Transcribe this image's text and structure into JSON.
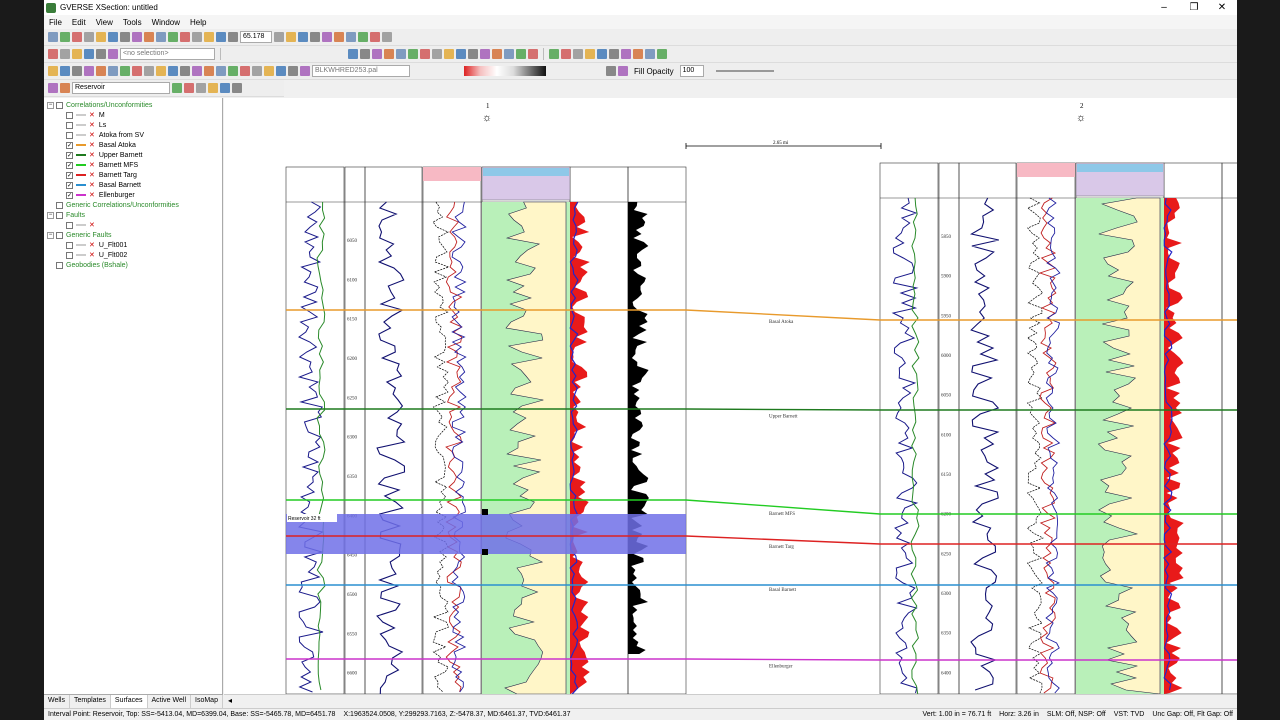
{
  "window": {
    "title": "GVERSE XSection: untitled",
    "minimize": "–",
    "maximize": "❐",
    "close": "✕"
  },
  "menu": [
    "File",
    "Edit",
    "View",
    "Tools",
    "Window",
    "Help"
  ],
  "toolbar": {
    "zoom_value": "65.178",
    "selection_placeholder": "<no selection>",
    "palette_value": "BLKWHRED253.pal",
    "fill_opacity_label": "Fill Opacity",
    "fill_opacity_value": "100",
    "reservoir_combo": "Reservoir"
  },
  "tree": [
    {
      "label": "Correlations/Unconformities",
      "level": 0,
      "expand": "−",
      "checked": false,
      "green": true
    },
    {
      "label": "M",
      "level": 1,
      "checked": false,
      "color": "#cccccc"
    },
    {
      "label": "Ls",
      "level": 1,
      "checked": false,
      "color": "#cccccc"
    },
    {
      "label": "Atoka from SV",
      "level": 1,
      "checked": false,
      "color": "#cccccc"
    },
    {
      "label": "Basal Atoka",
      "level": 1,
      "checked": true,
      "color": "#e89a2c"
    },
    {
      "label": "Upper Barnett",
      "level": 1,
      "checked": true,
      "color": "#1f7a1f"
    },
    {
      "label": "Barnett MFS",
      "level": 1,
      "checked": true,
      "color": "#22cc22"
    },
    {
      "label": "Barnett Targ",
      "level": 1,
      "checked": true,
      "color": "#dd2222"
    },
    {
      "label": "Basal Barnett",
      "level": 1,
      "checked": true,
      "color": "#2a8fd0"
    },
    {
      "label": "Ellenburger",
      "level": 1,
      "checked": true,
      "color": "#cc33cc"
    },
    {
      "label": "Generic Correlations/Unconformities",
      "level": 0,
      "expand": "",
      "checked": false,
      "green": true
    },
    {
      "label": "Faults",
      "level": 0,
      "expand": "−",
      "checked": false,
      "green": true
    },
    {
      "label": "",
      "level": 1,
      "checked": false,
      "color": "#cccccc"
    },
    {
      "label": "Generic Faults",
      "level": 0,
      "expand": "−",
      "checked": false,
      "green": true
    },
    {
      "label": "U_Flt001",
      "level": 1,
      "checked": false,
      "color": "#cccccc"
    },
    {
      "label": "U_Flt002",
      "level": 1,
      "checked": false,
      "color": "#cccccc"
    },
    {
      "label": "Geobodies (Bshale)",
      "level": 0,
      "expand": "",
      "checked": false,
      "green": true
    }
  ],
  "bottom_tabs": [
    "Wells",
    "Templates",
    "Surfaces",
    "Active Well",
    "IsoMap"
  ],
  "active_tab": "Surfaces",
  "canvas": {
    "well1_label": "1",
    "well2_label": "2",
    "scale_label": "2.65 mi",
    "reservoir_label": "Reservoir 32 ft",
    "well1_depths": [
      "6050",
      "6100",
      "6150",
      "6200",
      "6250",
      "6300",
      "6350",
      "6400",
      "6450",
      "6500",
      "6550",
      "6600"
    ],
    "well2_depths": [
      "5850",
      "5900",
      "5950",
      "6000",
      "6050",
      "6100",
      "6150",
      "6200",
      "6250",
      "6300",
      "6350",
      "6400"
    ],
    "surfaces": [
      {
        "name": "Basal Atoka",
        "color": "#e89a2c"
      },
      {
        "name": "Upper Barnett",
        "color": "#1f7a1f"
      },
      {
        "name": "Barnett MFS",
        "color": "#22cc22"
      },
      {
        "name": "Barnett Targ",
        "color": "#dd2222"
      },
      {
        "name": "Basal Barnett",
        "color": "#2a8fd0"
      },
      {
        "name": "Ellenburger",
        "color": "#cc33cc"
      }
    ]
  },
  "status": {
    "interval": "Interval Point: Reservoir, Top: SS=-5413.04, MD=6399.04, Base: SS=-5465.78, MD=6451.78",
    "coords": "X:1963524.0508, Y:299293.7163, Z:-5478.37, MD:6461.37, TVD:6461.37",
    "vert": "Vert: 1.00 in = 76.71 ft",
    "horz": "Horz: 3.26 in",
    "slm": "SLM: Off, NSP: Off",
    "vst": "VST: TVD",
    "gap": "Unc Gap: Off, Flt Gap: Off"
  }
}
